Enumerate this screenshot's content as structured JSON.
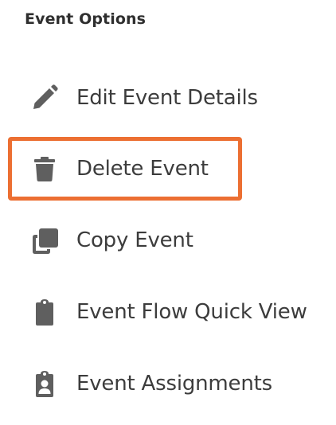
{
  "panel": {
    "title": "Event Options"
  },
  "menu": {
    "items": [
      {
        "label": "Edit Event Details",
        "icon": "pencil-icon"
      },
      {
        "label": "Delete Event",
        "icon": "trash-icon"
      },
      {
        "label": "Copy Event",
        "icon": "copy-icon"
      },
      {
        "label": "Event Flow Quick View",
        "icon": "clipboard-icon"
      },
      {
        "label": "Event Assignments",
        "icon": "clipboard-user-icon"
      }
    ]
  },
  "colors": {
    "icon": "#5f5f5f",
    "text": "#3c3c3c",
    "highlight": "#ec6f32"
  }
}
